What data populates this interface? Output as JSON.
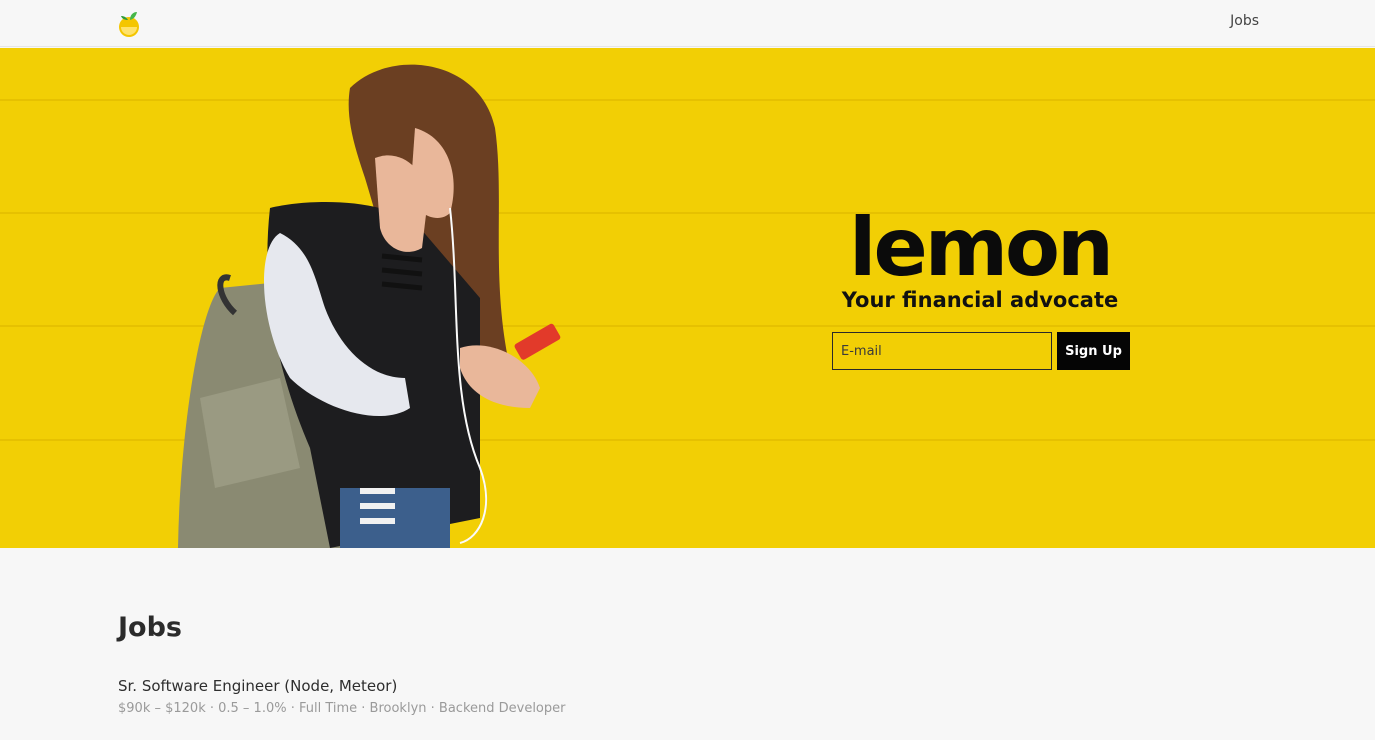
{
  "nav": {
    "logo": "lemon-logo-icon",
    "jobs_link": "Jobs"
  },
  "hero": {
    "wordmark": "lemon",
    "tagline": "Your financial advocate",
    "email_placeholder": "E-mail",
    "email_value": "",
    "signup_label": "Sign Up",
    "background_color": "#f2cf05"
  },
  "jobs": {
    "heading": "Jobs",
    "items": [
      {
        "title": "Sr. Software Engineer (Node, Meteor)",
        "meta": "$90k – $120k · 0.5 – 1.0% · Full Time · Brooklyn · Backend Developer"
      }
    ]
  }
}
